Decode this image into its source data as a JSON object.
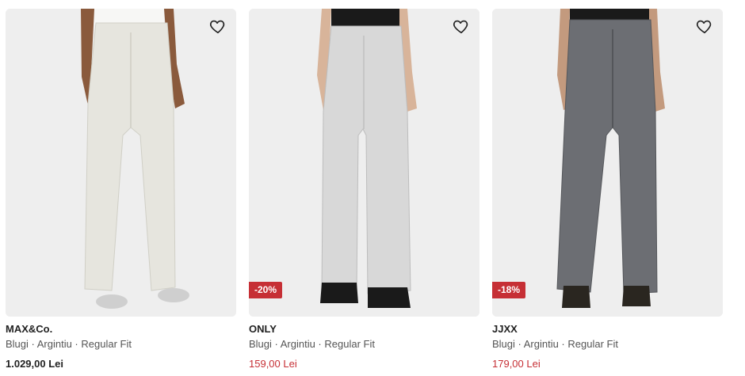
{
  "products": [
    {
      "brand": "MAX&Co.",
      "description": "Blugi · Argintiu · Regular Fit",
      "price": "1.029,00 Lei",
      "discount": "",
      "favorite_icon": "heart-outline-icon",
      "pants_color": "#e7e6df"
    },
    {
      "brand": "ONLY",
      "description": "Blugi · Argintiu · Regular Fit",
      "price": "159,00 Lei",
      "discount": "-20%",
      "favorite_icon": "heart-outline-icon",
      "pants_color": "#d9d9d9"
    },
    {
      "brand": "JJXX",
      "description": "Blugi · Argintiu · Regular Fit",
      "price": "179,00 Lei",
      "discount": "-18%",
      "favorite_icon": "heart-outline-icon",
      "pants_color": "#6b6d72"
    }
  ],
  "colors": {
    "sale": "#c62f35",
    "badge_bg": "#c62f35",
    "card_bg": "#efefef"
  }
}
